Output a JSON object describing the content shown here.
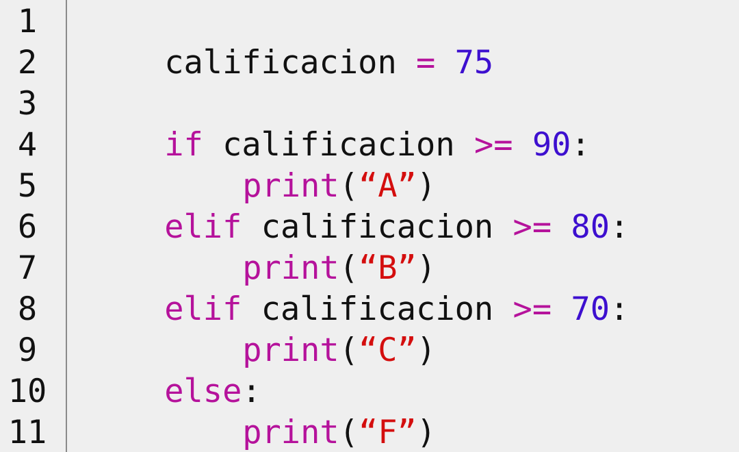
{
  "editor": {
    "line_numbers": [
      "1",
      "2",
      "3",
      "4",
      "5",
      "6",
      "7",
      "8",
      "9",
      "10",
      "11"
    ],
    "lines": {
      "l1": {
        "var": "calificacion",
        "op": "=",
        "num": "75"
      },
      "l3": {
        "kw": "if",
        "var": "calificacion",
        "op": ">=",
        "num": "90",
        "colon": ":"
      },
      "l4": {
        "func": "print",
        "open": "(",
        "str": "“A”",
        "close": ")"
      },
      "l5": {
        "kw": "elif",
        "var": "calificacion",
        "op": ">=",
        "num": "80",
        "colon": ":"
      },
      "l6": {
        "func": "print",
        "open": "(",
        "str": "“B”",
        "close": ")"
      },
      "l7": {
        "kw": "elif",
        "var": "calificacion",
        "op": ">=",
        "num": "70",
        "colon": ":"
      },
      "l8": {
        "func": "print",
        "open": "(",
        "str": "“C”",
        "close": ")"
      },
      "l9": {
        "kw": "else",
        "colon": ":"
      },
      "l10": {
        "func": "print",
        "open": "(",
        "str": "“F”",
        "close": ")"
      }
    },
    "colors": {
      "keyword": "#b5129b",
      "number": "#3d0fcf",
      "string": "#d40e0e",
      "text": "#111111",
      "background": "#efefef"
    }
  }
}
